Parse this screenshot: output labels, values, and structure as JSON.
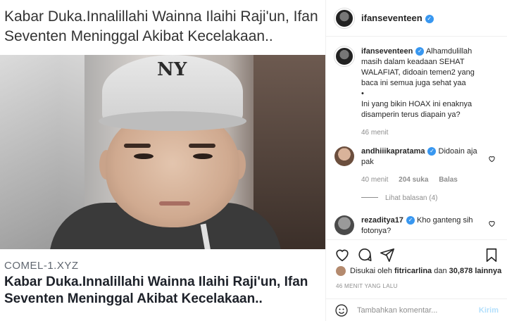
{
  "post": {
    "headline_top": "Kabar Duka.Innalillahi Wainna Ilaihi Raji'un, Ifan Seventen Meninggal Akibat Kecelakaan..",
    "cap_logo": "NY",
    "domain": "COMEL-1.XYZ",
    "headline_bottom": "Kabar Duka.Innalillahi Wainna Ilaihi Raji'un, Ifan Seventen Meninggal Akibat Kecelakaan.."
  },
  "header": {
    "username": "ifanseventeen",
    "verified_glyph": "✓"
  },
  "caption": {
    "username": "ifanseventeen",
    "text1": "Alhamdulillah masih dalam keadaan SEHAT WALAFIAT, didoain temen2 yang baca ini semua juga sehat yaa",
    "bullet": "•",
    "text2": "Ini yang bikin HOAX ini enaknya disamperin terus diapain ya?",
    "time": "46 menit"
  },
  "comments": [
    {
      "username": "andhiiikapratama",
      "text": "Didoain aja pak",
      "time": "40 menit",
      "likes": "204 suka",
      "reply": "Balas"
    },
    {
      "username": "rezaditya17",
      "text": "Kho ganteng sih fotonya?"
    }
  ],
  "replies_link": "Lihat balasan (4)",
  "likes": {
    "prefix": "Disukai oleh",
    "user": "fitricarlina",
    "mid": "dan",
    "count": "30,878 lainnya"
  },
  "timestamp": "46 MENIT YANG LALU",
  "add_comment": {
    "placeholder": "Tambahkan komentar...",
    "post_label": "Kirim"
  },
  "icons": [
    "verified-icon",
    "heart-icon",
    "comment-icon",
    "share-icon",
    "bookmark-icon",
    "emoji-icon"
  ]
}
